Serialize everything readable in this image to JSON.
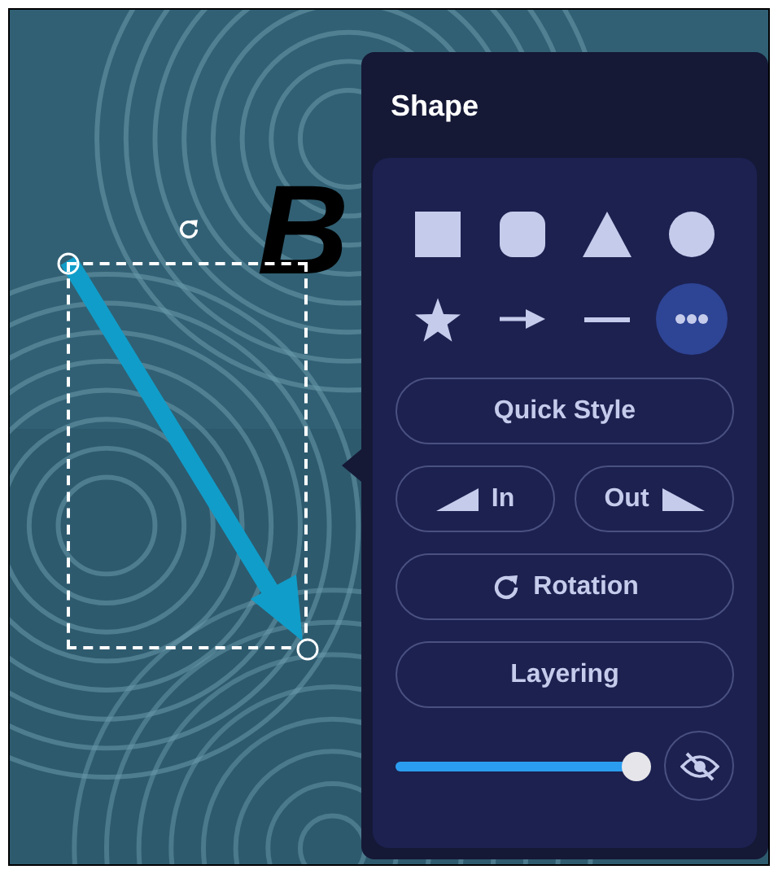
{
  "canvas": {
    "text": "B"
  },
  "panel": {
    "title": "Shape",
    "shapes": [
      {
        "kind": "square",
        "selected": false
      },
      {
        "kind": "rounded",
        "selected": false
      },
      {
        "kind": "triangle",
        "selected": false
      },
      {
        "kind": "circle",
        "selected": false
      },
      {
        "kind": "star",
        "selected": false
      },
      {
        "kind": "arrow",
        "selected": false
      },
      {
        "kind": "line",
        "selected": false
      },
      {
        "kind": "more",
        "selected": true
      }
    ],
    "buttons": [
      {
        "kind": "quick",
        "label": "Quick Style"
      },
      {
        "kind": "in",
        "label": "In"
      },
      {
        "kind": "out",
        "label": "Out"
      },
      {
        "kind": "rotation",
        "label": "Rotation"
      },
      {
        "kind": "layering",
        "label": "Layering"
      }
    ],
    "opacity": {
      "level": 0.97
    },
    "visible": false
  }
}
